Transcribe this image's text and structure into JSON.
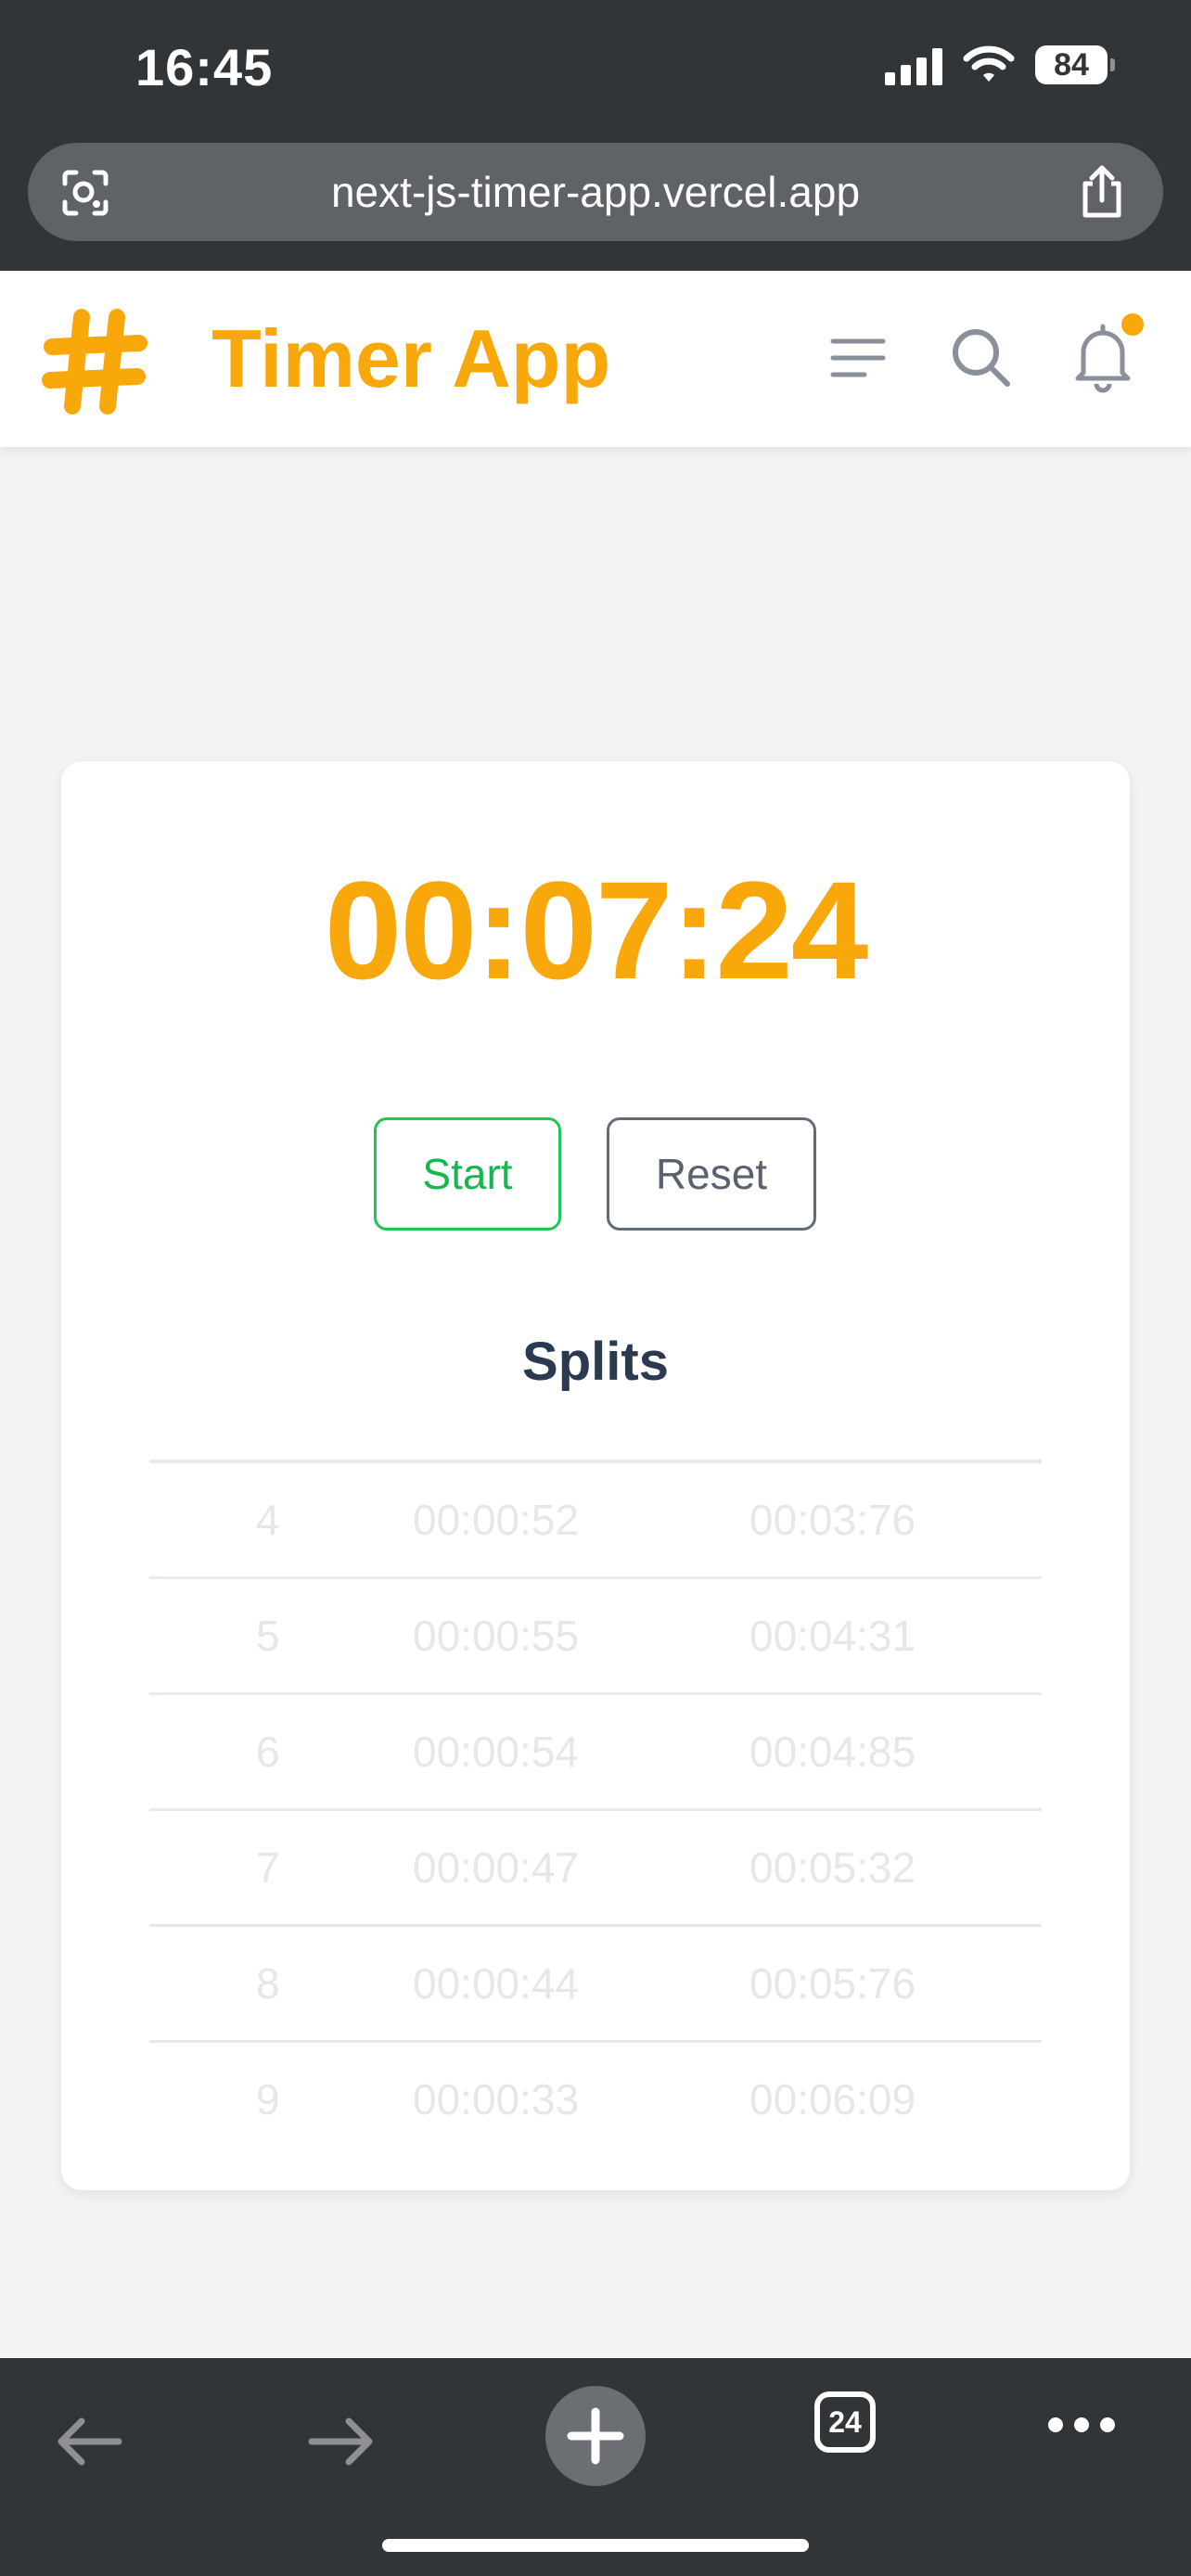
{
  "status_bar": {
    "time": "16:45",
    "battery": "84"
  },
  "browser": {
    "url": "next-js-timer-app.vercel.app",
    "tabs_count": "24"
  },
  "header": {
    "title": "Timer App"
  },
  "timer": {
    "display": "00:07:24"
  },
  "controls": {
    "start_label": "Start",
    "reset_label": "Reset"
  },
  "splits": {
    "title": "Splits",
    "rows": [
      {
        "num": "4",
        "lap": "00:00:52",
        "total": "00:03:76"
      },
      {
        "num": "5",
        "lap": "00:00:55",
        "total": "00:04:31"
      },
      {
        "num": "6",
        "lap": "00:00:54",
        "total": "00:04:85"
      },
      {
        "num": "7",
        "lap": "00:00:47",
        "total": "00:05:32"
      },
      {
        "num": "8",
        "lap": "00:00:44",
        "total": "00:05:76"
      },
      {
        "num": "9",
        "lap": "00:00:33",
        "total": "00:06:09"
      }
    ]
  },
  "colors": {
    "accent": "#f9a80b",
    "start": "#1fc556",
    "reset": "#636b79",
    "chrome": "#323538"
  }
}
